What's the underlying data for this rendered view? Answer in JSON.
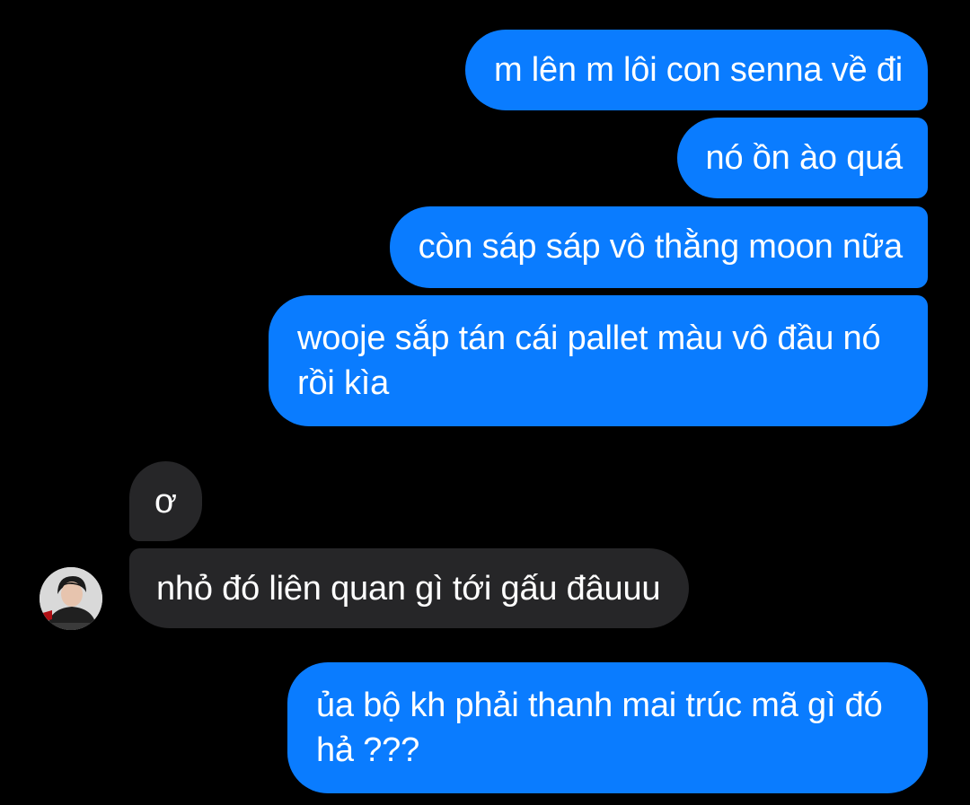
{
  "messages": [
    {
      "sender": "me",
      "text": "m lên m lôi con senna về đi"
    },
    {
      "sender": "me",
      "text": "nó ồn ào quá"
    },
    {
      "sender": "me",
      "text": "còn sáp sáp vô thằng moon nữa"
    },
    {
      "sender": "me",
      "text": "wooje sắp tán cái pallet màu vô đầu nó rồi kìa"
    },
    {
      "sender": "them",
      "text": "ơ"
    },
    {
      "sender": "them",
      "text": "nhỏ đó liên quan gì tới gấu đâuuu"
    },
    {
      "sender": "me",
      "text": "ủa bộ kh phải thanh mai trúc mã gì đó hả ???"
    }
  ],
  "colors": {
    "background": "#000000",
    "outgoing_bubble": "#0a7cff",
    "incoming_bubble": "#262628",
    "text": "#ffffff"
  },
  "contact": {
    "avatar_icon": "profile-photo"
  }
}
